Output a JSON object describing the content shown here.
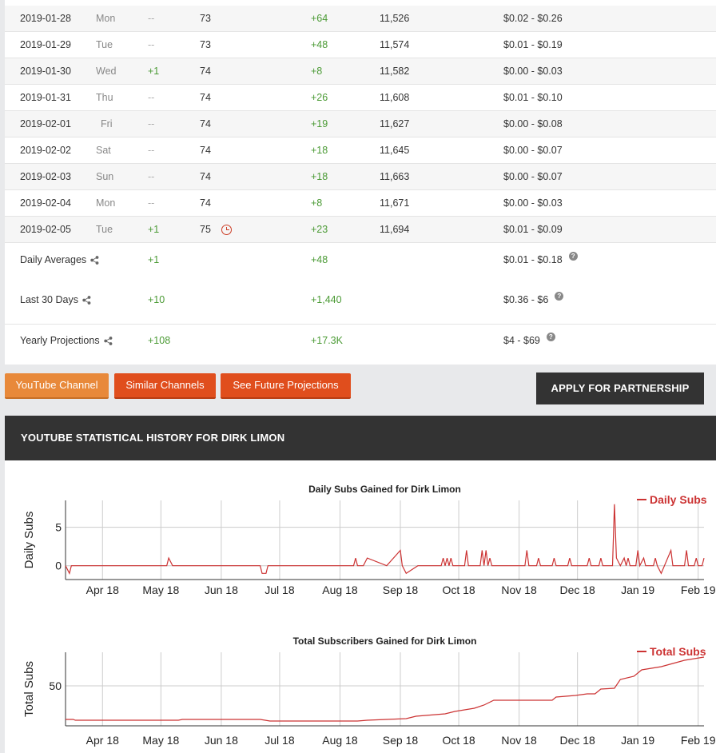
{
  "table": {
    "rows": [
      {
        "date": "2019-01-28",
        "day": "Mon",
        "videos": "--",
        "total_videos": "73",
        "subs": "+64",
        "total_subs": "11,526",
        "earnings": "$0.02  -  $0.26"
      },
      {
        "date": "2019-01-29",
        "day": "Tue",
        "videos": "--",
        "total_videos": "73",
        "subs": "+48",
        "total_subs": "11,574",
        "earnings": "$0.01  -  $0.19"
      },
      {
        "date": "2019-01-30",
        "day": "Wed",
        "videos": "+1",
        "total_videos": "74",
        "subs": "+8",
        "total_subs": "11,582",
        "earnings": "$0.00  -  $0.03"
      },
      {
        "date": "2019-01-31",
        "day": "Thu",
        "videos": "--",
        "total_videos": "74",
        "subs": "+26",
        "total_subs": "11,608",
        "earnings": "$0.01  -  $0.10"
      },
      {
        "date": "2019-02-01",
        "day": "Fri",
        "videos": "--",
        "total_videos": "74",
        "subs": "+19",
        "total_subs": "11,627",
        "earnings": "$0.00  -  $0.08"
      },
      {
        "date": "2019-02-02",
        "day": "Sat",
        "videos": "--",
        "total_videos": "74",
        "subs": "+18",
        "total_subs": "11,645",
        "earnings": "$0.00  -  $0.07"
      },
      {
        "date": "2019-02-03",
        "day": "Sun",
        "videos": "--",
        "total_videos": "74",
        "subs": "+18",
        "total_subs": "11,663",
        "earnings": "$0.00  -  $0.07"
      },
      {
        "date": "2019-02-04",
        "day": "Mon",
        "videos": "--",
        "total_videos": "74",
        "subs": "+8",
        "total_subs": "11,671",
        "earnings": "$0.00  -  $0.03"
      },
      {
        "date": "2019-02-05",
        "day": "Tue",
        "videos": "+1",
        "total_videos": "75",
        "subs": "+23",
        "total_subs": "11,694",
        "earnings": "$0.01  -  $0.09"
      }
    ],
    "clock_icon": "clock-icon",
    "summary": {
      "daily": {
        "label": "Daily Averages",
        "videos": "+1",
        "subs": "+48",
        "earnings": "$0.01  -  $0.18"
      },
      "last30": {
        "label": "Last 30 Days",
        "videos": "+10",
        "subs": "+1,440",
        "earnings": "$0.36  -  $6"
      },
      "yearly": {
        "label": "Yearly Projections",
        "videos": "+108",
        "subs": "+17.3K",
        "earnings": "$4  -  $69"
      }
    }
  },
  "buttons": {
    "youtube_channel": "YouTube Channel",
    "similar_channels": "Similar Channels",
    "future_projections": "See Future Projections",
    "apply_partnership": "APPLY FOR PARTNERSHIP"
  },
  "history": {
    "title": "YOUTUBE STATISTICAL HISTORY FOR DIRK LIMON"
  },
  "colors": {
    "green": "#4a9a34",
    "line": "#cc3333",
    "orange": "#e8893a",
    "red_orange": "#e04e1d",
    "dark": "#333333"
  },
  "chart_data": [
    {
      "type": "line",
      "title": "Daily Subs Gained for Dirk Limon",
      "ylabel": "Daily Subs",
      "xlabel": "",
      "x_ticks": [
        "Apr 18",
        "May 18",
        "Jun 18",
        "Jul 18",
        "Aug 18",
        "Sep 18",
        "Oct 18",
        "Nov 18",
        "Dec 18",
        "Jan 19",
        "Feb 19"
      ],
      "y_ticks": [
        0,
        5
      ],
      "ylim": [
        -1.8,
        8.5
      ],
      "grid": true,
      "legend": "top-right",
      "series": [
        {
          "name": "Daily Subs",
          "points": [
            [
              0,
              0
            ],
            [
              2,
              -1
            ],
            [
              3,
              0
            ],
            [
              52,
              0
            ],
            [
              53,
              1
            ],
            [
              55,
              0
            ],
            [
              100,
              0
            ],
            [
              101,
              -1
            ],
            [
              103,
              -1
            ],
            [
              104,
              0
            ],
            [
              148,
              0
            ],
            [
              149,
              1
            ],
            [
              150,
              0
            ],
            [
              153,
              0
            ],
            [
              155,
              1
            ],
            [
              165,
              0
            ],
            [
              172,
              2
            ],
            [
              173,
              0
            ],
            [
              175,
              -1
            ],
            [
              181,
              0
            ],
            [
              193,
              0
            ],
            [
              194,
              1
            ],
            [
              195,
              0
            ],
            [
              196,
              1
            ],
            [
              197,
              0
            ],
            [
              198,
              1
            ],
            [
              199,
              0
            ],
            [
              205,
              0
            ],
            [
              206,
              2
            ],
            [
              207,
              0
            ],
            [
              213,
              0
            ],
            [
              214,
              2
            ],
            [
              215,
              0
            ],
            [
              216,
              2
            ],
            [
              217,
              0
            ],
            [
              218,
              1
            ],
            [
              219,
              0
            ],
            [
              236,
              0
            ],
            [
              237,
              2
            ],
            [
              238,
              0
            ],
            [
              242,
              0
            ],
            [
              243,
              1
            ],
            [
              244,
              0
            ],
            [
              250,
              0
            ],
            [
              251,
              1
            ],
            [
              252,
              0
            ],
            [
              258,
              0
            ],
            [
              259,
              1
            ],
            [
              260,
              0
            ],
            [
              268,
              0
            ],
            [
              269,
              1
            ],
            [
              270,
              0
            ],
            [
              274,
              0
            ],
            [
              275,
              1
            ],
            [
              276,
              0
            ],
            [
              281,
              0
            ],
            [
              282,
              8
            ],
            [
              283,
              1
            ],
            [
              285,
              0
            ],
            [
              287,
              1
            ],
            [
              288,
              0
            ],
            [
              289,
              1
            ],
            [
              290,
              0
            ],
            [
              293,
              0
            ],
            [
              294,
              2
            ],
            [
              295,
              0
            ],
            [
              297,
              1
            ],
            [
              298,
              0
            ],
            [
              302,
              0
            ],
            [
              303,
              1
            ],
            [
              304,
              0
            ],
            [
              306,
              -1
            ],
            [
              311,
              2
            ],
            [
              312,
              0
            ],
            [
              318,
              0
            ],
            [
              319,
              2
            ],
            [
              320,
              0
            ],
            [
              323,
              0
            ],
            [
              324,
              1
            ],
            [
              325,
              0
            ],
            [
              327,
              0
            ],
            [
              328,
              1
            ]
          ]
        }
      ]
    },
    {
      "type": "line",
      "title": "Total Subscribers Gained for Dirk Limon",
      "ylabel": "Total Subs",
      "xlabel": "",
      "x_ticks": [
        "Apr 18",
        "May 18",
        "Jun 18",
        "Jul 18",
        "Aug 18",
        "Sep 18",
        "Oct 18",
        "Nov 18",
        "Dec 18",
        "Jan 19",
        "Feb 19"
      ],
      "y_ticks": [
        50
      ],
      "ylim": [
        0,
        92
      ],
      "grid": true,
      "legend": "top-right",
      "series": [
        {
          "name": "Total Subs",
          "points": [
            [
              0,
              8
            ],
            [
              4,
              8
            ],
            [
              5,
              7
            ],
            [
              58,
              7
            ],
            [
              60,
              8
            ],
            [
              100,
              8
            ],
            [
              105,
              6
            ],
            [
              150,
              6
            ],
            [
              155,
              7
            ],
            [
              165,
              8
            ],
            [
              175,
              9
            ],
            [
              180,
              12
            ],
            [
              195,
              15
            ],
            [
              200,
              18
            ],
            [
              210,
              22
            ],
            [
              215,
              26
            ],
            [
              220,
              32
            ],
            [
              250,
              32
            ],
            [
              252,
              36
            ],
            [
              262,
              38
            ],
            [
              268,
              40
            ],
            [
              272,
              40
            ],
            [
              275,
              46
            ],
            [
              282,
              47
            ],
            [
              285,
              58
            ],
            [
              292,
              62
            ],
            [
              296,
              70
            ],
            [
              306,
              74
            ],
            [
              312,
              78
            ],
            [
              318,
              82
            ],
            [
              323,
              84
            ],
            [
              328,
              86
            ]
          ]
        }
      ]
    }
  ]
}
